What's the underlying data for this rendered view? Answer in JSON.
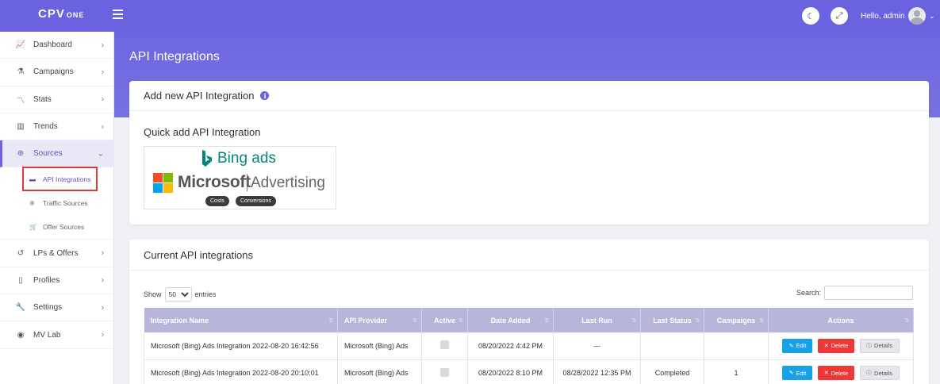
{
  "topbar": {
    "logo_text": "CPV",
    "logo_sub": "ONE",
    "greeting": "Hello, admin",
    "icons": [
      "menu-icon",
      "moon-icon",
      "fullscreen-icon",
      "avatar-icon",
      "chevron-down-icon"
    ]
  },
  "sidebar": {
    "items": [
      {
        "label": "Dashboard",
        "icon": "chart-line-icon"
      },
      {
        "label": "Campaigns",
        "icon": "flask-icon"
      },
      {
        "label": "Stats",
        "icon": "stats-icon"
      },
      {
        "label": "Trends",
        "icon": "trends-icon"
      },
      {
        "label": "Sources",
        "icon": "globe-icon"
      },
      {
        "label": "LPs & Offers",
        "icon": "refresh-icon"
      },
      {
        "label": "Profiles",
        "icon": "clipboard-icon"
      },
      {
        "label": "Settings",
        "icon": "wrench-icon"
      },
      {
        "label": "MV Lab",
        "icon": "lab-icon"
      }
    ],
    "sources_sub": [
      {
        "label": "API Integrations",
        "icon": "folder-icon"
      },
      {
        "label": "Traffic Sources",
        "icon": "globe-icon"
      },
      {
        "label": "Offer Sources",
        "icon": "cart-icon"
      }
    ]
  },
  "page": {
    "title": "API Integrations"
  },
  "add_card": {
    "title": "Add new API Integration",
    "quick_title": "Quick add API Integration",
    "tile": {
      "bing_text": "Bing ads",
      "ms_text": "Microsoft",
      "ms_adv": "Advertising",
      "pills": [
        "Costs",
        "Conversions"
      ]
    }
  },
  "current_card": {
    "title": "Current API integrations",
    "show_label": "Show",
    "entries_value": "50",
    "entries_label": "entries",
    "search_label": "Search:",
    "columns": [
      "Integration Name",
      "API Provider",
      "Active",
      "Date Added",
      "Last Run",
      "Last Status",
      "Campaigns",
      "Actions"
    ],
    "rows": [
      {
        "name": "Microsoft (Bing) Ads Integration 2022-08-20 16:42:56",
        "provider": "Microsoft (Bing) Ads",
        "date_added": "08/20/2022 4:42 PM",
        "last_run": "---",
        "last_status": "",
        "campaigns": ""
      },
      {
        "name": "Microsoft (Bing) Ads Integration 2022-08-20 20:10:01",
        "provider": "Microsoft (Bing) Ads",
        "date_added": "08/20/2022 8:10 PM",
        "last_run": "08/28/2022 12:35 PM",
        "last_status": "Completed",
        "campaigns": "1"
      }
    ],
    "actions": {
      "edit": "Edit",
      "delete": "Delete",
      "details": "Details"
    }
  },
  "colors": {
    "primary": "#6a62de",
    "edit": "#17a2e8",
    "delete": "#ee3838",
    "highlight_box": "#e53935"
  }
}
